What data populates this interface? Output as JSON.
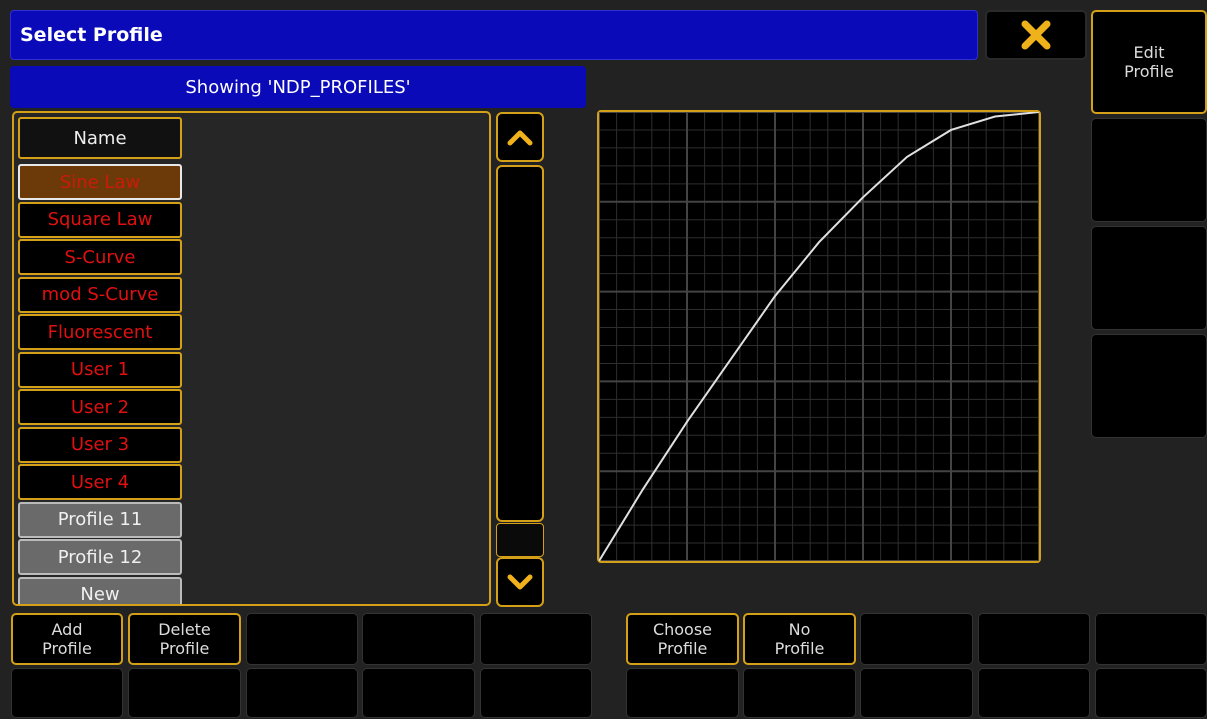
{
  "window": {
    "title": "Select Profile",
    "close_icon": "x-icon",
    "edit_profile_label": "Edit\nProfile"
  },
  "showing": "Showing 'NDP_PROFILES'",
  "list": {
    "header": "Name",
    "items": [
      {
        "label": "Sine Law",
        "state": "selected"
      },
      {
        "label": "Square Law",
        "state": "builtin"
      },
      {
        "label": "S-Curve",
        "state": "builtin"
      },
      {
        "label": "mod S-Curve",
        "state": "builtin"
      },
      {
        "label": "Fluorescent",
        "state": "builtin"
      },
      {
        "label": "User 1",
        "state": "builtin"
      },
      {
        "label": "User 2",
        "state": "builtin"
      },
      {
        "label": "User 3",
        "state": "builtin"
      },
      {
        "label": "User 4",
        "state": "builtin"
      },
      {
        "label": "Profile 11",
        "state": "user"
      },
      {
        "label": "Profile 12",
        "state": "user"
      },
      {
        "label": "New",
        "state": "user"
      }
    ]
  },
  "scroll": {
    "up_icon": "chevron-up-icon",
    "down_icon": "chevron-down-icon"
  },
  "curve": {
    "name": "Sine Law",
    "points": [
      [
        0,
        0
      ],
      [
        0.1,
        0.16
      ],
      [
        0.2,
        0.31
      ],
      [
        0.3,
        0.45
      ],
      [
        0.4,
        0.59
      ],
      [
        0.5,
        0.71
      ],
      [
        0.6,
        0.81
      ],
      [
        0.7,
        0.9
      ],
      [
        0.8,
        0.96
      ],
      [
        0.9,
        0.99
      ],
      [
        1,
        1
      ]
    ],
    "line_color": "#e0e0e0",
    "grid_color": "#444444"
  },
  "buttons": {
    "add_profile": "Add\nProfile",
    "delete_profile": "Delete\nProfile",
    "choose_profile": "Choose\nProfile",
    "no_profile": "No\nProfile"
  },
  "colors": {
    "accent": "#d4a017",
    "title_bar": "#0a0ab8",
    "builtin_text": "#e01010",
    "selected_bg": "#6b3a08"
  }
}
